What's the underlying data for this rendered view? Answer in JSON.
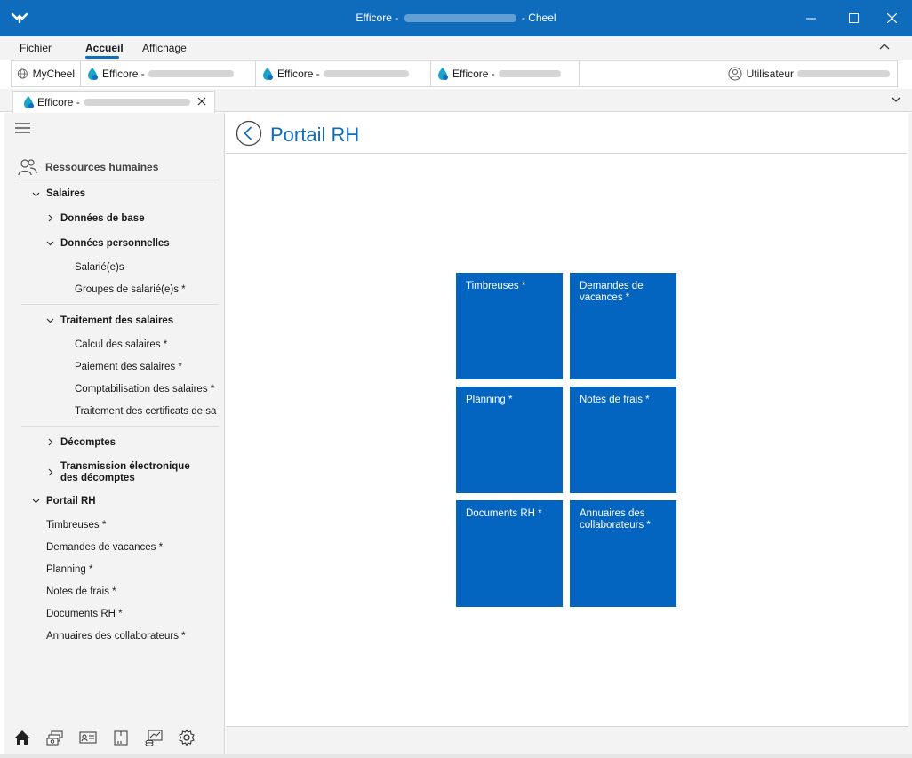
{
  "window": {
    "title_prefix": "Efficore -",
    "title_suffix": "- Cheel"
  },
  "menubar": {
    "items": [
      "Fichier",
      "Accueil",
      "Affichage"
    ]
  },
  "tabs": {
    "mycheel": "MyCheel",
    "efficore_1": "Efficore -",
    "efficore_2": "Efficore -",
    "efficore_3": "Efficore -",
    "user_label": "Utilisateur"
  },
  "doc_tab": {
    "label": "Efficore -"
  },
  "sidebar": {
    "section": "Ressources humaines",
    "salaires": "Salaires",
    "donnees_base": "Données de base",
    "donnees_perso": "Données personnelles",
    "salaries": "Salarié(e)s",
    "groupes": "Groupes de salarié(e)s *",
    "traitement": "Traitement des salaires",
    "calcul": "Calcul des salaires *",
    "paiement": "Paiement des salaires *",
    "comptabilisation": "Comptabilisation des salaires *",
    "certificats": "Traitement des certificats de sa",
    "decomptes": "Décomptes",
    "transmission_1": "Transmission électronique",
    "transmission_2": "des décomptes",
    "portail": "Portail RH",
    "timbreuses": "Timbreuses *",
    "vacances": "Demandes de vacances *",
    "planning": "Planning *",
    "notes": "Notes de frais *",
    "documents": "Documents RH *",
    "annuaires": "Annuaires des collaborateurs *"
  },
  "content": {
    "title": "Portail RH",
    "tiles": [
      {
        "line1": "Timbreuses *",
        "line2": ""
      },
      {
        "line1": "Demandes de",
        "line2": "vacances *"
      },
      {
        "line1": "Planning *",
        "line2": ""
      },
      {
        "line1": "Notes de frais *",
        "line2": ""
      },
      {
        "line1": "Documents RH *",
        "line2": ""
      },
      {
        "line1": "Annuaires des",
        "line2": "collaborateurs *"
      }
    ]
  },
  "colors": {
    "accent": "#0f6cbd",
    "tile": "#0465c1"
  }
}
